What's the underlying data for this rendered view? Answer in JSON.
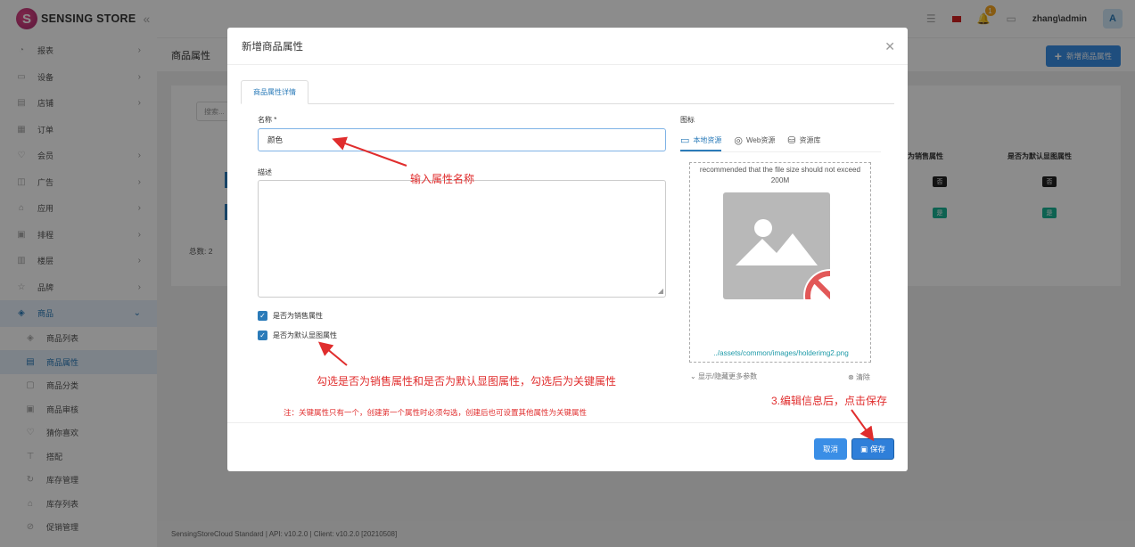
{
  "topbar": {
    "brand": "SENSING STORE",
    "collapse_icon": "chevrons-left-icon",
    "notifications": "1",
    "user": "zhang\\admin",
    "avatar_letter": "A"
  },
  "sidebar": {
    "items": [
      {
        "label": "报表",
        "icon": "chart-icon",
        "arrow": true
      },
      {
        "label": "设备",
        "icon": "device-icon",
        "arrow": true
      },
      {
        "label": "店铺",
        "icon": "store-icon",
        "arrow": true
      },
      {
        "label": "订单",
        "icon": "order-icon",
        "arrow": false
      },
      {
        "label": "会员",
        "icon": "member-icon",
        "arrow": true
      },
      {
        "label": "广告",
        "icon": "ad-icon",
        "arrow": true
      },
      {
        "label": "应用",
        "icon": "app-icon",
        "arrow": true
      },
      {
        "label": "排程",
        "icon": "schedule-icon",
        "arrow": true
      },
      {
        "label": "楼层",
        "icon": "floor-icon",
        "arrow": true
      },
      {
        "label": "品牌",
        "icon": "brand-icon",
        "arrow": true
      }
    ],
    "open_item": {
      "label": "商品",
      "icon": "product-icon"
    },
    "sub_items": [
      {
        "label": "商品列表",
        "active": false
      },
      {
        "label": "商品属性",
        "active": true
      },
      {
        "label": "商品分类",
        "active": false
      },
      {
        "label": "商品审核",
        "active": false
      },
      {
        "label": "猜你喜欢",
        "active": false
      },
      {
        "label": "搭配",
        "active": false
      },
      {
        "label": "库存管理",
        "active": false
      },
      {
        "label": "库存列表",
        "active": false
      },
      {
        "label": "促销管理",
        "active": false
      }
    ]
  },
  "page": {
    "title": "商品属性",
    "add_button": "新增商品属性",
    "search_placeholder": "搜索...",
    "columns": [
      "为销售属性",
      "是否为默认显图属性"
    ],
    "rows": [
      [
        "否",
        "否"
      ],
      [
        "是",
        "是"
      ]
    ],
    "total": "总数: 2",
    "footer": "SensingStoreCloud Standard | API: v10.2.0 | Client: v10.2.0 [20210508]"
  },
  "modal": {
    "title": "新增商品属性",
    "tab": "商品属性详情",
    "name_label": "名称 *",
    "name_value": "颜色",
    "desc_label": "描述",
    "chk_sales": "是否为销售属性",
    "chk_default": "是否为默认显图属性",
    "icon_label": "图标",
    "icon_tabs": [
      "本地资源",
      "Web资源",
      "资源库"
    ],
    "preview_note": "recommended that the file size should not exceed 200M",
    "preview_path": "../assets/common/images/holderimg2.png",
    "more_params": "显示/隐藏更多参数",
    "clear": "清除",
    "cancel": "取消",
    "save": "保存"
  },
  "annotations": {
    "name_hint": "输入属性名称",
    "check_hint": "勾选是否为销售属性和是否为默认显图属性，勾选后为关键属性",
    "note": "注：关键属性只有一个，创建第一个属性时必须勾选，创建后也可设置其他属性为关键属性",
    "save_hint": "3.编辑信息后，点击保存",
    "color": "#e02d2d"
  }
}
